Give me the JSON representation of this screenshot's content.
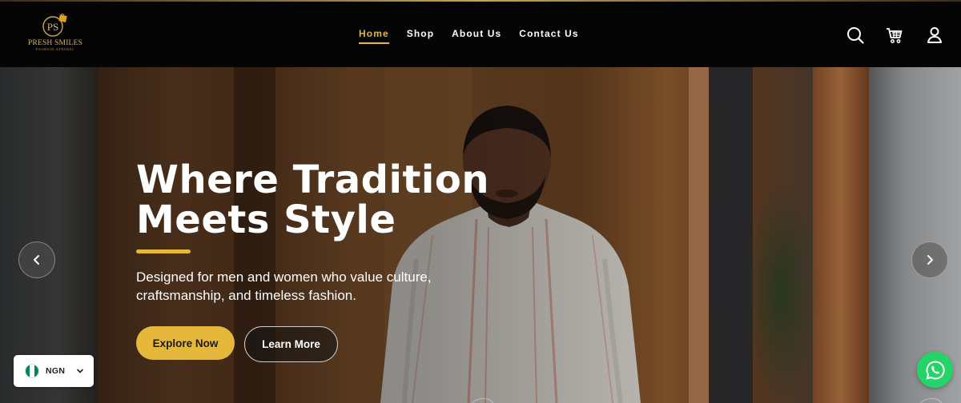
{
  "brand": {
    "monogram": "PS",
    "name": "Presh Smiles",
    "tagline": "Fashion Apparel"
  },
  "nav": {
    "items": [
      {
        "label": "Home",
        "active": true
      },
      {
        "label": "Shop",
        "active": false
      },
      {
        "label": "About Us",
        "active": false
      },
      {
        "label": "Contact Us",
        "active": false
      }
    ]
  },
  "header_icons": [
    "search-icon",
    "cart-icon",
    "account-icon"
  ],
  "hero": {
    "title_line1": "Where Tradition",
    "title_line2": "Meets Style",
    "subtitle": "Designed for men and women who value culture, craftsmanship, and timeless fashion.",
    "primary_cta": "Explore Now",
    "secondary_cta": "Learn More"
  },
  "slider": {
    "prev_icon": "chevron-left-icon",
    "next_icon": "chevron-right-icon"
  },
  "currency": {
    "code": "NGN",
    "flag_colors": [
      "#008751",
      "#ffffff",
      "#008751"
    ]
  },
  "colors": {
    "accent": "#e5b73b",
    "header_bg": "#050505",
    "whatsapp": "#25d366"
  }
}
